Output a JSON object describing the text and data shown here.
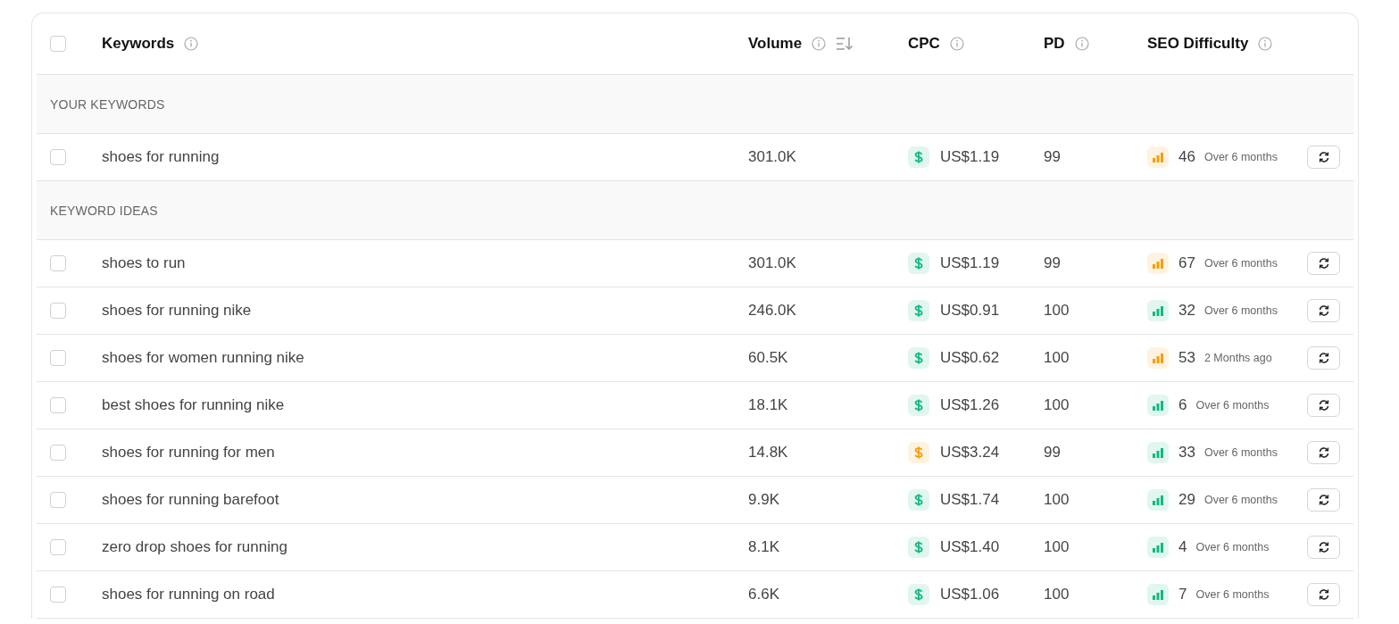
{
  "header": {
    "checked": false,
    "columns": [
      {
        "label": "Keywords",
        "info": true,
        "sorted": false
      },
      {
        "label": "Volume",
        "info": true,
        "sorted": true
      },
      {
        "label": "CPC",
        "info": true,
        "sorted": false
      },
      {
        "label": "PD",
        "info": true,
        "sorted": false
      },
      {
        "label": "SEO Difficulty",
        "info": true,
        "sorted": false
      }
    ]
  },
  "sections": [
    {
      "title": "YOUR KEYWORDS",
      "rows": [
        {
          "keyword": "shoes for running",
          "checked": false,
          "volume": "301.0K",
          "cpc": {
            "value": "US$1.19",
            "color": "#10b981"
          },
          "pd": "99",
          "difficulty": {
            "score": "46",
            "updated": "Over 6 months",
            "color": "#f59e0b"
          }
        }
      ]
    },
    {
      "title": "KEYWORD IDEAS",
      "rows": [
        {
          "keyword": "shoes to run",
          "checked": false,
          "volume": "301.0K",
          "cpc": {
            "value": "US$1.19",
            "color": "#10b981"
          },
          "pd": "99",
          "difficulty": {
            "score": "67",
            "updated": "Over 6 months",
            "color": "#f59e0b"
          }
        },
        {
          "keyword": "shoes for running nike",
          "checked": false,
          "volume": "246.0K",
          "cpc": {
            "value": "US$0.91",
            "color": "#10b981"
          },
          "pd": "100",
          "difficulty": {
            "score": "32",
            "updated": "Over 6 months",
            "color": "#10b981"
          }
        },
        {
          "keyword": "shoes for women running nike",
          "checked": false,
          "volume": "60.5K",
          "cpc": {
            "value": "US$0.62",
            "color": "#10b981"
          },
          "pd": "100",
          "difficulty": {
            "score": "53",
            "updated": "2 Months ago",
            "color": "#f59e0b"
          }
        },
        {
          "keyword": "best shoes for running nike",
          "checked": false,
          "volume": "18.1K",
          "cpc": {
            "value": "US$1.26",
            "color": "#10b981"
          },
          "pd": "100",
          "difficulty": {
            "score": "6",
            "updated": "Over 6 months",
            "color": "#10b981"
          }
        },
        {
          "keyword": "shoes for running for men",
          "checked": false,
          "volume": "14.8K",
          "cpc": {
            "value": "US$3.24",
            "color": "#f59e0b"
          },
          "pd": "99",
          "difficulty": {
            "score": "33",
            "updated": "Over 6 months",
            "color": "#10b981"
          }
        },
        {
          "keyword": "shoes for running barefoot",
          "checked": false,
          "volume": "9.9K",
          "cpc": {
            "value": "US$1.74",
            "color": "#10b981"
          },
          "pd": "100",
          "difficulty": {
            "score": "29",
            "updated": "Over 6 months",
            "color": "#10b981"
          }
        },
        {
          "keyword": "zero drop shoes for running",
          "checked": false,
          "volume": "8.1K",
          "cpc": {
            "value": "US$1.40",
            "color": "#10b981"
          },
          "pd": "100",
          "difficulty": {
            "score": "4",
            "updated": "Over 6 months",
            "color": "#10b981"
          }
        },
        {
          "keyword": "shoes for running on road",
          "checked": false,
          "volume": "6.6K",
          "cpc": {
            "value": "US$1.06",
            "color": "#10b981"
          },
          "pd": "100",
          "difficulty": {
            "score": "7",
            "updated": "Over 6 months",
            "color": "#10b981"
          }
        }
      ]
    }
  ]
}
